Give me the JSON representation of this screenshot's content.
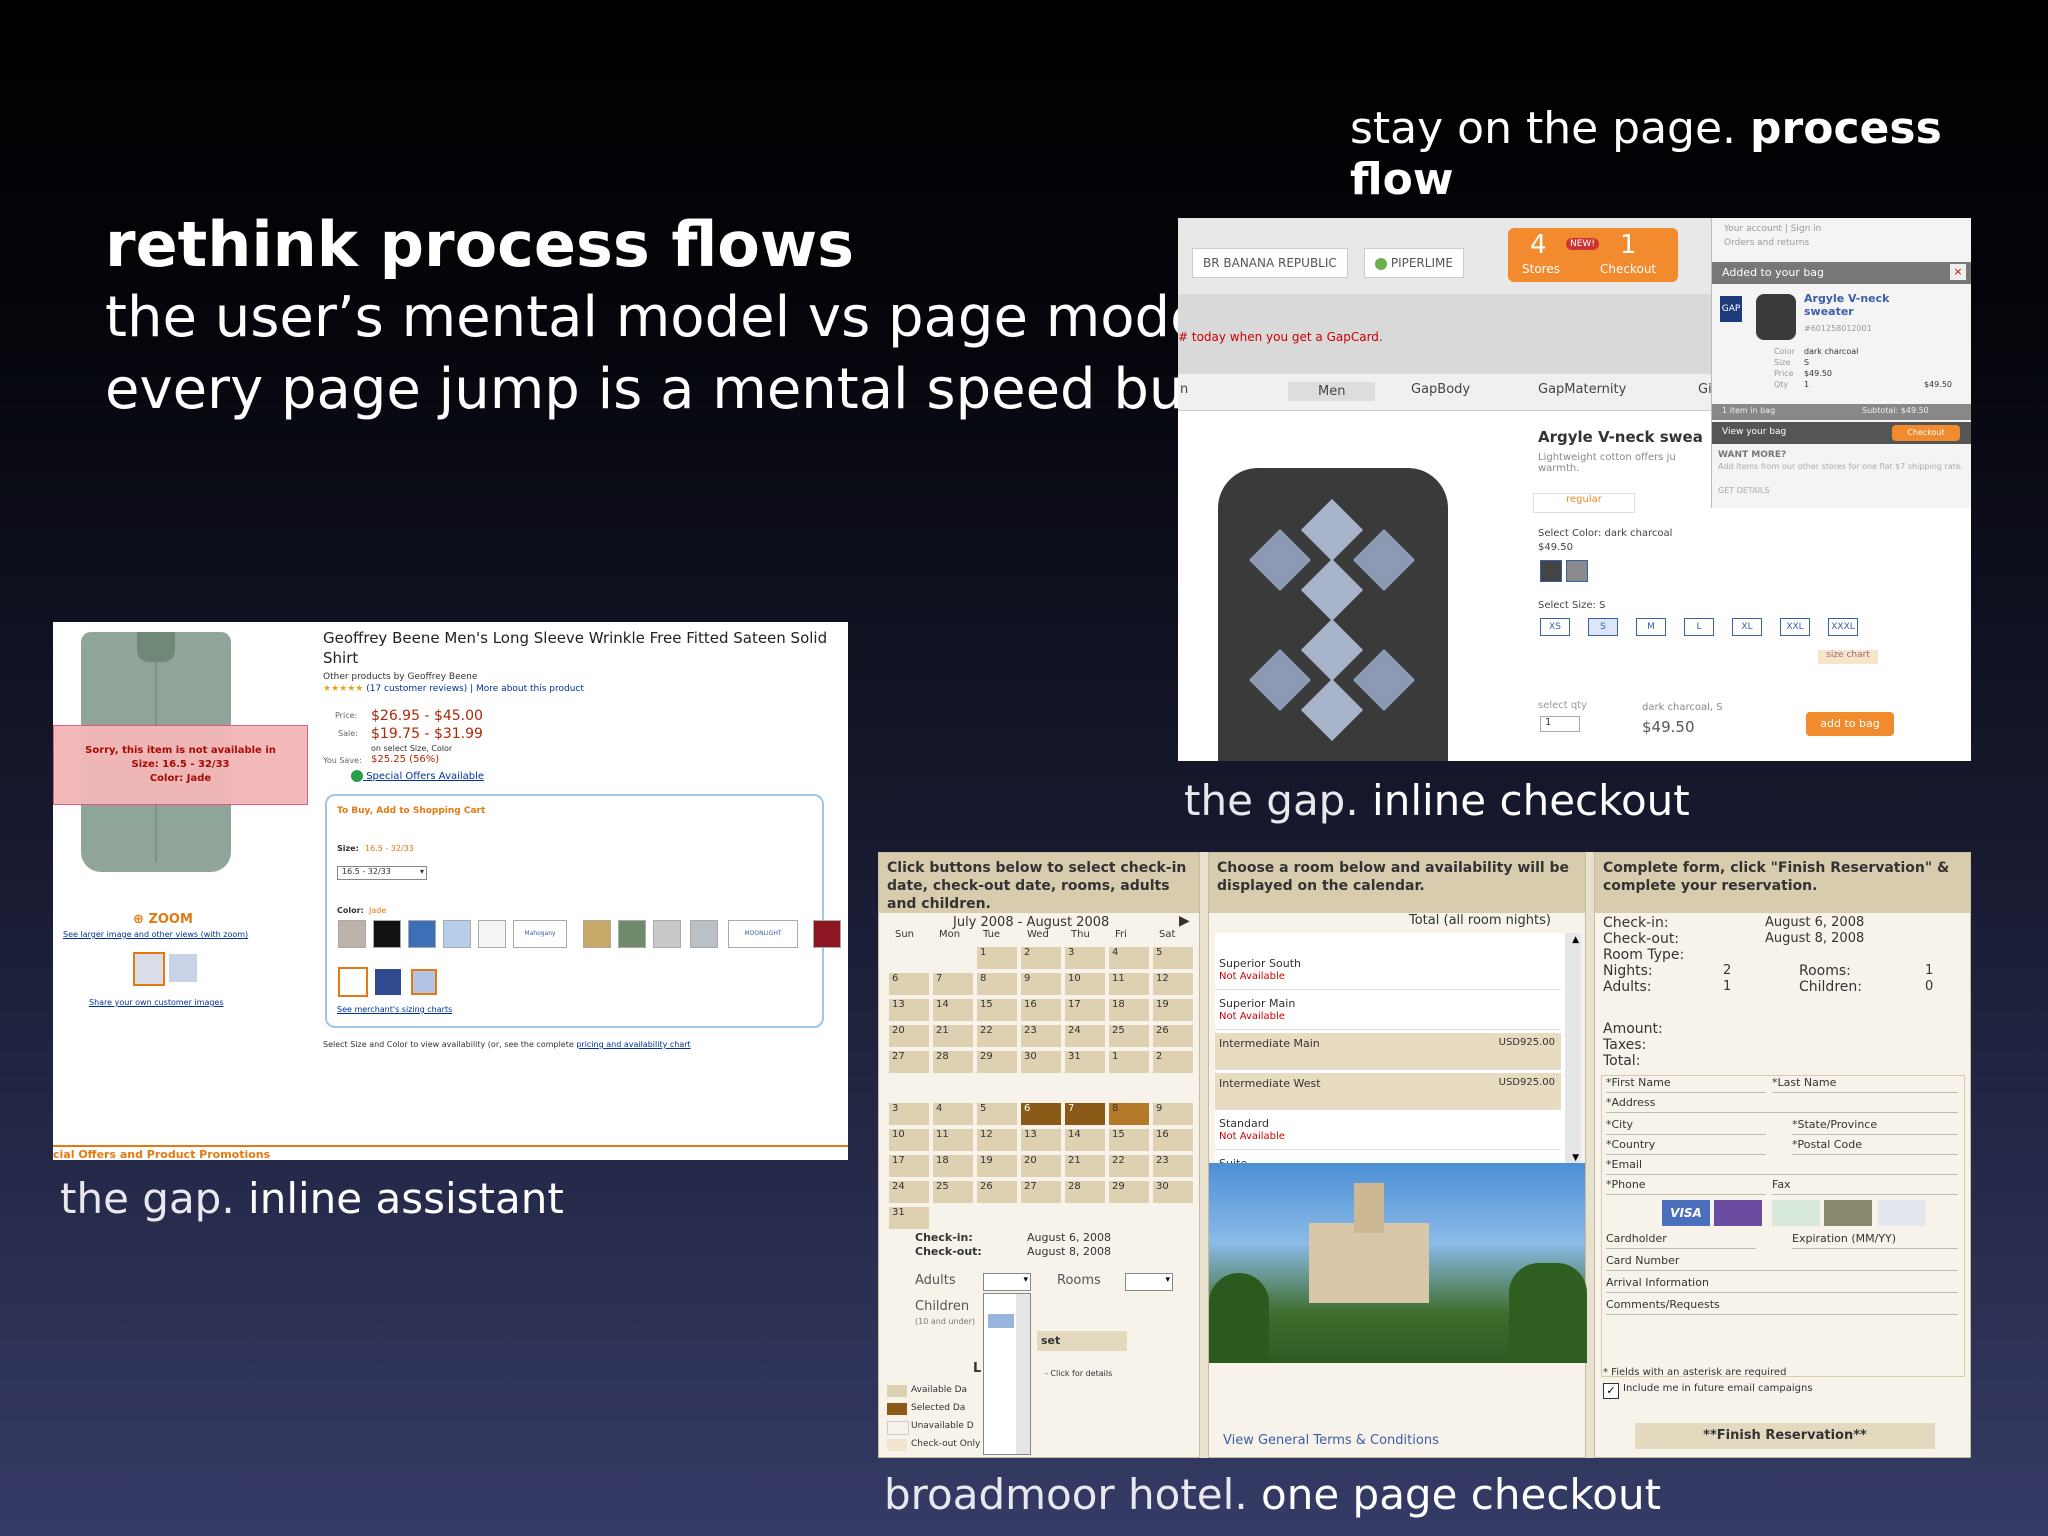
{
  "slide": {
    "top_tag_normal": "stay on the page.",
    "top_tag_bold": "process flow",
    "title": "rethink process flows",
    "subtitle_1": "the user’s mental model vs page model",
    "subtitle_2": "every page jump is a mental speed bump"
  },
  "captions": {
    "gap_checkout": {
      "normal": "the gap.",
      "bold": "inline checkout"
    },
    "gap_assistant": {
      "normal": "the gap.",
      "bold": "inline assistant"
    },
    "broadmoor": {
      "normal": "broadmoor hotel.",
      "bold": "one page checkout"
    }
  },
  "gap": {
    "logo_br": "BR BANANA REPUBLIC",
    "logo_piperlime": "PIPERLIME",
    "stores_count": "4",
    "stores_label": "Stores",
    "new_badge": "NEW!",
    "checkout_count": "1",
    "checkout_label": "Checkout",
    "account_links": "Your account | Sign in",
    "orders_returns": "Orders and returns",
    "promo": "# today when you get a GapCard.",
    "tabs": [
      "n",
      "Men",
      "GapBody",
      "GapMaternity",
      "Gi"
    ],
    "product_title": "Argyle V-neck swea",
    "product_desc": "Lightweight cotton offers ju warmth.",
    "tab_regular": "regular",
    "select_color": "Select Color: dark charcoal",
    "price_small": "$49.50",
    "select_size": "Select Size: S",
    "sizes": [
      "XS",
      "S",
      "M",
      "L",
      "XL",
      "XXL",
      "XXXL"
    ],
    "size_chart": "size chart",
    "select_qty": "select qty",
    "qty_value": "1",
    "summary_label": "dark charcoal, S",
    "summary_price": "$49.50",
    "add_button": "add to bag",
    "bag": {
      "header": "Added to your bag",
      "close": "×",
      "gap_logo": "GAP",
      "item_title": "Argyle V-neck sweater",
      "item_code": "#601258012001",
      "color_label": "Color",
      "color_value": "dark charcoal",
      "size_label": "Size",
      "size_value": "S",
      "price_label": "Price",
      "price_value": "$49.50",
      "qty_label": "Qty",
      "qty_value": "1",
      "line_total": "$49.50",
      "items_in_bag": "1 item in bag",
      "subtotal_label": "Subtotal: $49.50",
      "view_bag": "View your bag",
      "checkout": "Checkout",
      "want_more": "WANT MORE?",
      "want_more_text": "Add items from our other stores for one flat $7 shipping rate.",
      "get_details": "GET DETAILS"
    }
  },
  "amazon": {
    "sorry_line1": "Sorry, this item is not available in",
    "sorry_line2": "Size: 16.5 - 32/33",
    "sorry_line3": "Color: Jade",
    "zoom": "ZOOM",
    "larger_images": "See larger image and other views (with zoom)",
    "share_images": "Share your own customer images",
    "title": "Geoffrey Beene Men's Long Sleeve Wrinkle Free Fitted Sateen Solid Shirt",
    "other_products": "Other products by Geoffrey Beene",
    "reviews": "(17 customer reviews) | More about this product",
    "price_label": "Price:",
    "price": "$26.95 - $45.00",
    "sale_label": "Sale:",
    "sale": "$19.75 - $31.99",
    "on_select": "on select Size, Color",
    "save_label": "You Save:",
    "save": "$25.25 (56%)",
    "offers": "Special Offers Available",
    "cart_heading": "To Buy, Add to Shopping Cart",
    "size_label": "Size:",
    "size_value": "16.5 - 32/33",
    "size_select": "16.5 - 32/33",
    "color_label": "Color:",
    "color_value": "Jade",
    "swatch_mahogany": "Mahogany",
    "swatch_moonlight": "MOONLIGHT",
    "sizing_charts": "See merchant's sizing charts",
    "footer_note": "Select Size and Color to view availability (or, see the complete",
    "footer_link": "pricing and availability chart",
    "promotions": "cial Offers and Product Promotions"
  },
  "broadmoor": {
    "col1_head": "Click buttons below to select check-in date, check-out date, rooms, adults and children.",
    "calendar_title": "July 2008 - August 2008",
    "weekdays": [
      "Sun",
      "Mon",
      "Tue",
      "Wed",
      "Thu",
      "Fri",
      "Sat"
    ],
    "checkin_label": "Check-in:",
    "checkin_value": "August 6, 2008",
    "checkout_label": "Check-out:",
    "checkout_value": "August 8, 2008",
    "adults_label": "Adults",
    "rooms_label": "Rooms",
    "children_label": "Children",
    "children_note": "(10 and under)",
    "reset_label": "set",
    "legend_label": "L",
    "legend_click": "- Click for details",
    "legend": [
      "Available Da",
      "Selected Da",
      "Unavailable D",
      "Check-out Only"
    ],
    "col2_head": "Choose a room below and availability will be displayed on the calendar.",
    "total_label": "Total (all room nights)",
    "rooms": [
      {
        "name": "Superior South",
        "status": "Not Available",
        "price": ""
      },
      {
        "name": "Superior Main",
        "status": "Not Available",
        "price": ""
      },
      {
        "name": "Intermediate Main",
        "status": "",
        "price": "USD925.00"
      },
      {
        "name": "Intermediate West",
        "status": "",
        "price": "USD925.00"
      },
      {
        "name": "Standard",
        "status": "Not Available",
        "price": ""
      },
      {
        "name": "Suite",
        "status": "",
        "price": ""
      }
    ],
    "terms": "View General Terms & Conditions",
    "col3_head": "Complete form, click \"Finish Reservation\" & complete your reservation.",
    "summary": {
      "checkin": "Check-in:",
      "checkin_value": "August 6, 2008",
      "checkout": "Check-out:",
      "checkout_value": "August 8, 2008",
      "room_type": "Room Type:",
      "nights": "Nights:",
      "nights_value": "2",
      "rooms": "Rooms:",
      "rooms_value": "1",
      "adults": "Adults:",
      "adults_value": "1",
      "children": "Children:",
      "children_value": "0",
      "amount": "Amount:",
      "taxes": "Taxes:",
      "total": "Total:"
    },
    "form_fields": [
      "*First Name",
      "*Last Name",
      "*Address",
      "*City",
      "*State/Province",
      "*Country",
      "*Postal Code",
      "*Email",
      "*Phone",
      "Fax"
    ],
    "card_visa": "VISA",
    "cardholder": "Cardholder",
    "expiration": "Expiration (MM/YY)",
    "card_number": "Card Number",
    "arrival": "Arrival Information",
    "comments": "Comments/Requests",
    "required_note": "* Fields with an asterisk are required",
    "include_me": "Include me in future email campaigns",
    "finish_button": "**Finish Reservation**"
  }
}
